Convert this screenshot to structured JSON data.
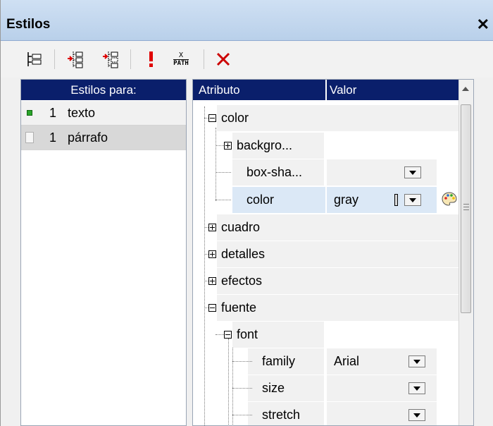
{
  "window": {
    "title": "Estilos",
    "close_glyph": "✕"
  },
  "toolbar": {
    "icons": [
      "add-style-icon",
      "append-property-icon",
      "insert-property-icon",
      "important-icon",
      "xpath-icon",
      "delete-icon"
    ],
    "xpath_top": "X",
    "xpath_bottom": "PATH"
  },
  "styles_panel": {
    "header": "Estilos para:",
    "items": [
      {
        "count": "1",
        "label": "texto",
        "selected": false
      },
      {
        "count": "1",
        "label": "párrafo",
        "selected": true
      }
    ]
  },
  "properties_panel": {
    "headers": {
      "attribute": "Atributo",
      "value": "Valor"
    },
    "rows": [
      {
        "name": "color",
        "value": ""
      },
      {
        "name": "backgro...",
        "value": ""
      },
      {
        "name": "box-sha...",
        "value": ""
      },
      {
        "name": "color",
        "value": "gray"
      },
      {
        "name": "cuadro",
        "value": ""
      },
      {
        "name": "detalles",
        "value": ""
      },
      {
        "name": "efectos",
        "value": ""
      },
      {
        "name": "fuente",
        "value": ""
      },
      {
        "name": "font",
        "value": ""
      },
      {
        "name": "family",
        "value": "Arial"
      },
      {
        "name": "size",
        "value": ""
      },
      {
        "name": "stretch",
        "value": ""
      }
    ]
  },
  "colors": {
    "header_bg": "#0a1f6b",
    "selection": "#dbe8f6",
    "accent_green": "#2aa52a"
  }
}
